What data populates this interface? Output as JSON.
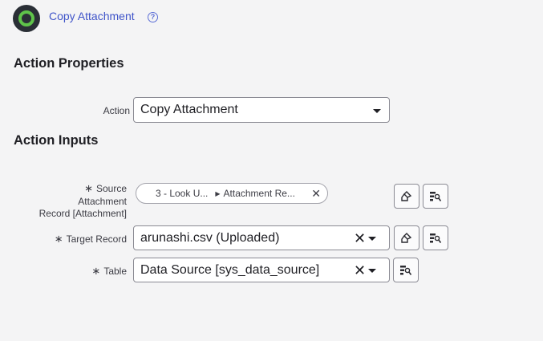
{
  "header": {
    "title": "Copy Attachment",
    "help_glyph": "?"
  },
  "sections": {
    "properties": "Action Properties",
    "inputs": "Action Inputs"
  },
  "action": {
    "label": "Action",
    "value": "Copy Attachment"
  },
  "source": {
    "required_mark": "∗",
    "label_line1": "Source",
    "label_line2": "Attachment",
    "label_line3": "Record [Attachment]",
    "pill_step": "3 - Look U...",
    "pill_field": "Attachment Re..."
  },
  "target": {
    "required_mark": "∗",
    "label": "Target Record",
    "value": "arunashi.csv (Uploaded)"
  },
  "table": {
    "required_mark": "∗",
    "label": "Table",
    "value": "Data Source [sys_data_source]"
  },
  "colors": {
    "accent": "#3f54c9",
    "logo_ring": "#5fc34a",
    "background": "#f4f4f5"
  }
}
